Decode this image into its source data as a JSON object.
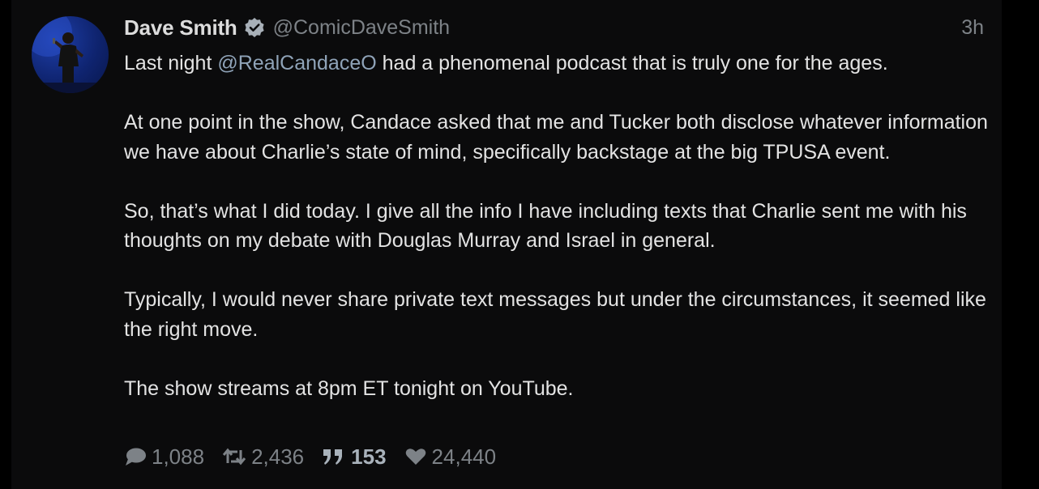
{
  "tweet": {
    "author": {
      "display_name": "Dave Smith",
      "handle": "@ComicDaveSmith",
      "verified": true
    },
    "timestamp": "3h",
    "paragraphs": [
      {
        "before": "Last night ",
        "mention": "@RealCandaceO",
        "after": " had a phenomenal podcast that is truly one for the ages."
      },
      {
        "text": "At one point in the show, Candace asked that me and Tucker both disclose whatever information we have about Charlie’s state of mind, specifically backstage at the big TPUSA event."
      },
      {
        "text": "So, that’s what I did today. I give all the info I have including texts that Charlie sent me with his thoughts on my debate with Douglas Murray and Israel in general."
      },
      {
        "text": "Typically, I would never share private text messages but under the circumstances, it seemed like the right move."
      },
      {
        "text": "The show streams at 8pm ET tonight on YouTube."
      }
    ],
    "stats": {
      "replies": "1,088",
      "retweets": "2,436",
      "quotes": "153",
      "likes": "24,440"
    }
  },
  "icons": {
    "verified": "verified-badge-icon",
    "reply": "speech-bubble-icon",
    "retweet": "retweet-arrows-icon",
    "quote": "quote-marks-icon",
    "like": "heart-icon"
  },
  "colors": {
    "background": "#000000",
    "card": "#0b0b0c",
    "text": "#e3e3e3",
    "muted": "#7d8287",
    "mention": "#8fa3b8"
  }
}
